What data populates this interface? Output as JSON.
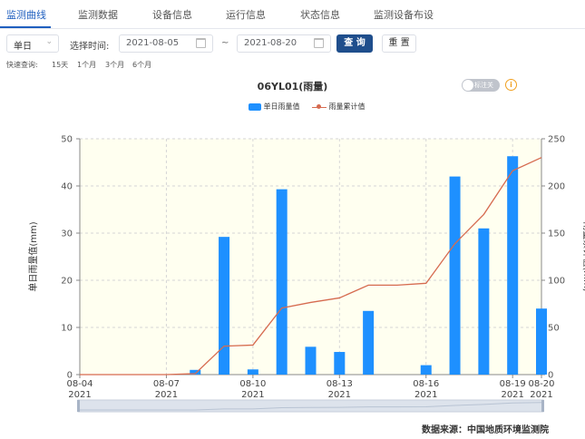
{
  "tabs": [
    {
      "label": "监测曲线",
      "active": true
    },
    {
      "label": "监测数据"
    },
    {
      "label": "设备信息"
    },
    {
      "label": "运行信息"
    },
    {
      "label": "状态信息"
    },
    {
      "label": "监测设备布设"
    }
  ],
  "toolbar": {
    "period_select": "单日",
    "time_label": "选择时间:",
    "start_date": "2021-08-05",
    "separator": "~",
    "end_date": "2021-08-20",
    "query_label": "查 询",
    "reset_label": "重 置"
  },
  "quick_query": {
    "label": "快速查询:",
    "options": [
      "15天",
      "1个月",
      "3个月",
      "6个月"
    ]
  },
  "chart_header": {
    "title": "06YL01(雨量)",
    "toggle_label": "标注关",
    "info_symbol": "i"
  },
  "source_text": "数据来源：中国地质环境监测院",
  "colors": {
    "bar": "#1e90ff",
    "line": "#d66b50",
    "plot_bg": "#fffff0",
    "accent": "#1f5fbf"
  },
  "chart_data": {
    "type": "bar",
    "title": "06YL01(雨量)",
    "x": [
      "2021-08-04",
      "2021-08-05",
      "2021-08-06",
      "2021-08-07",
      "2021-08-08",
      "2021-08-09",
      "2021-08-10",
      "2021-08-11",
      "2021-08-12",
      "2021-08-13",
      "2021-08-14",
      "2021-08-15",
      "2021-08-16",
      "2021-08-17",
      "2021-08-18",
      "2021-08-19",
      "2021-08-20"
    ],
    "x_tick_labels": [
      {
        "date": "2021-08-04",
        "line1": "08-04",
        "line2": "2021"
      },
      {
        "date": "2021-08-07",
        "line1": "08-07",
        "line2": "2021"
      },
      {
        "date": "2021-08-10",
        "line1": "08-10",
        "line2": "2021"
      },
      {
        "date": "2021-08-13",
        "line1": "08-13",
        "line2": "2021"
      },
      {
        "date": "2021-08-16",
        "line1": "08-16",
        "line2": "2021"
      },
      {
        "date": "2021-08-19",
        "line1": "08-19",
        "line2": "2021"
      },
      {
        "date": "2021-08-20",
        "line1": "08-20",
        "line2": "2021"
      }
    ],
    "series": [
      {
        "name": "单日雨量值",
        "type": "bar",
        "axis": "left",
        "values": [
          0,
          0,
          0,
          0,
          1.0,
          29.2,
          1.1,
          39.3,
          5.9,
          4.8,
          13.5,
          0,
          2.0,
          42.0,
          31.0,
          46.3,
          14.0
        ]
      },
      {
        "name": "雨量累计值",
        "type": "line",
        "axis": "right",
        "values": [
          0,
          0,
          0,
          0,
          1.0,
          30.2,
          31.3,
          70.6,
          76.5,
          81.3,
          94.8,
          94.8,
          96.8,
          138.8,
          169.8,
          216.1,
          230.1
        ]
      }
    ],
    "ylabel_left": "单日雨量值(mm)",
    "ylabel_right": "雨量累计值(mm)",
    "ylim_left": [
      0,
      50
    ],
    "ylim_right": [
      0,
      250
    ],
    "yticks_left": [
      0,
      10,
      20,
      30,
      40,
      50
    ],
    "yticks_right": [
      0,
      50,
      100,
      150,
      200,
      250
    ],
    "grid": true,
    "legend": "top-center"
  }
}
